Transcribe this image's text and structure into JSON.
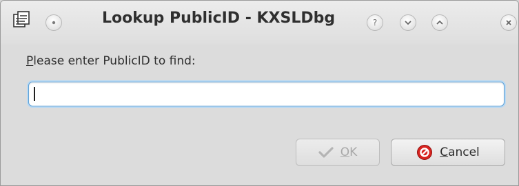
{
  "window": {
    "title": "Lookup PublicID - KXSLDbg",
    "controls": {
      "help_glyph": "?"
    }
  },
  "dialog": {
    "prompt_mnemonic": "P",
    "prompt_rest": "lease enter PublicID to find:",
    "input_value": "",
    "input_placeholder": ""
  },
  "buttons": {
    "ok": {
      "mnemonic": "O",
      "rest": "K",
      "icon": "checkmark-icon",
      "enabled": false
    },
    "cancel": {
      "mnemonic": "C",
      "rest": "ancel",
      "icon": "cancel-icon"
    }
  },
  "colors": {
    "focus_border": "#5da0d6",
    "cancel_icon_red": "#d8231f"
  }
}
